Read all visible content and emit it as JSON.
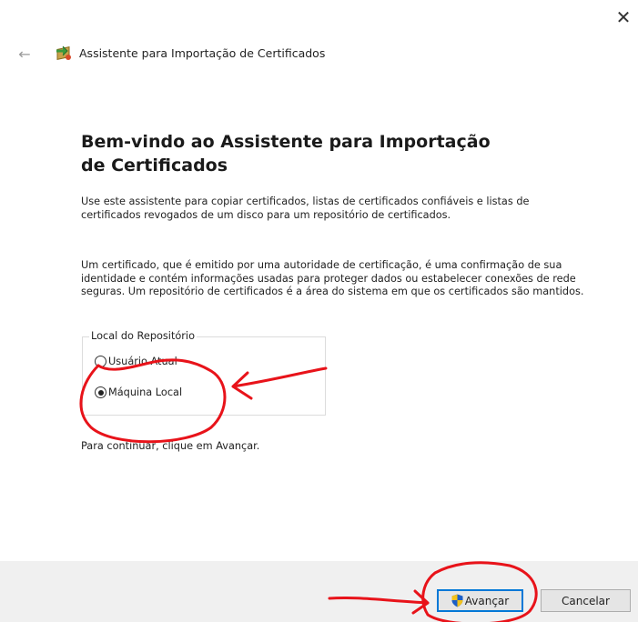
{
  "window": {
    "title": "Assistente para Importação de Certificados",
    "close_glyph": "✕",
    "back_glyph": "←"
  },
  "content": {
    "heading": "Bem-vindo ao Assistente para Importação de Certificados",
    "para1": "Use este assistente para copiar certificados, listas de certificados confiáveis e listas de certificados revogados de um disco para um repositório de certificados.",
    "para2": "Um certificado, que é emitido por uma autoridade de certificação, é uma confirmação de sua identidade e contém informações usadas para proteger dados ou estabelecer conexões de rede seguras. Um repositório de certificados é a área do sistema em que os certificados são mantidos.",
    "store_location": {
      "label": "Local do Repositório",
      "options": [
        {
          "label": "Usuário Atual",
          "selected": false
        },
        {
          "label": "Máquina Local",
          "selected": true
        }
      ]
    },
    "continue_text": "Para continuar, clique em Avançar."
  },
  "footer": {
    "next_label": "Avançar",
    "cancel_label": "Cancelar"
  },
  "colors": {
    "accent": "#0078d7",
    "annotation": "#e8131a",
    "footer_bg": "#f0f0f0"
  },
  "icons": [
    "close-icon",
    "back-arrow-icon",
    "certificate-icon",
    "uac-shield-icon"
  ]
}
